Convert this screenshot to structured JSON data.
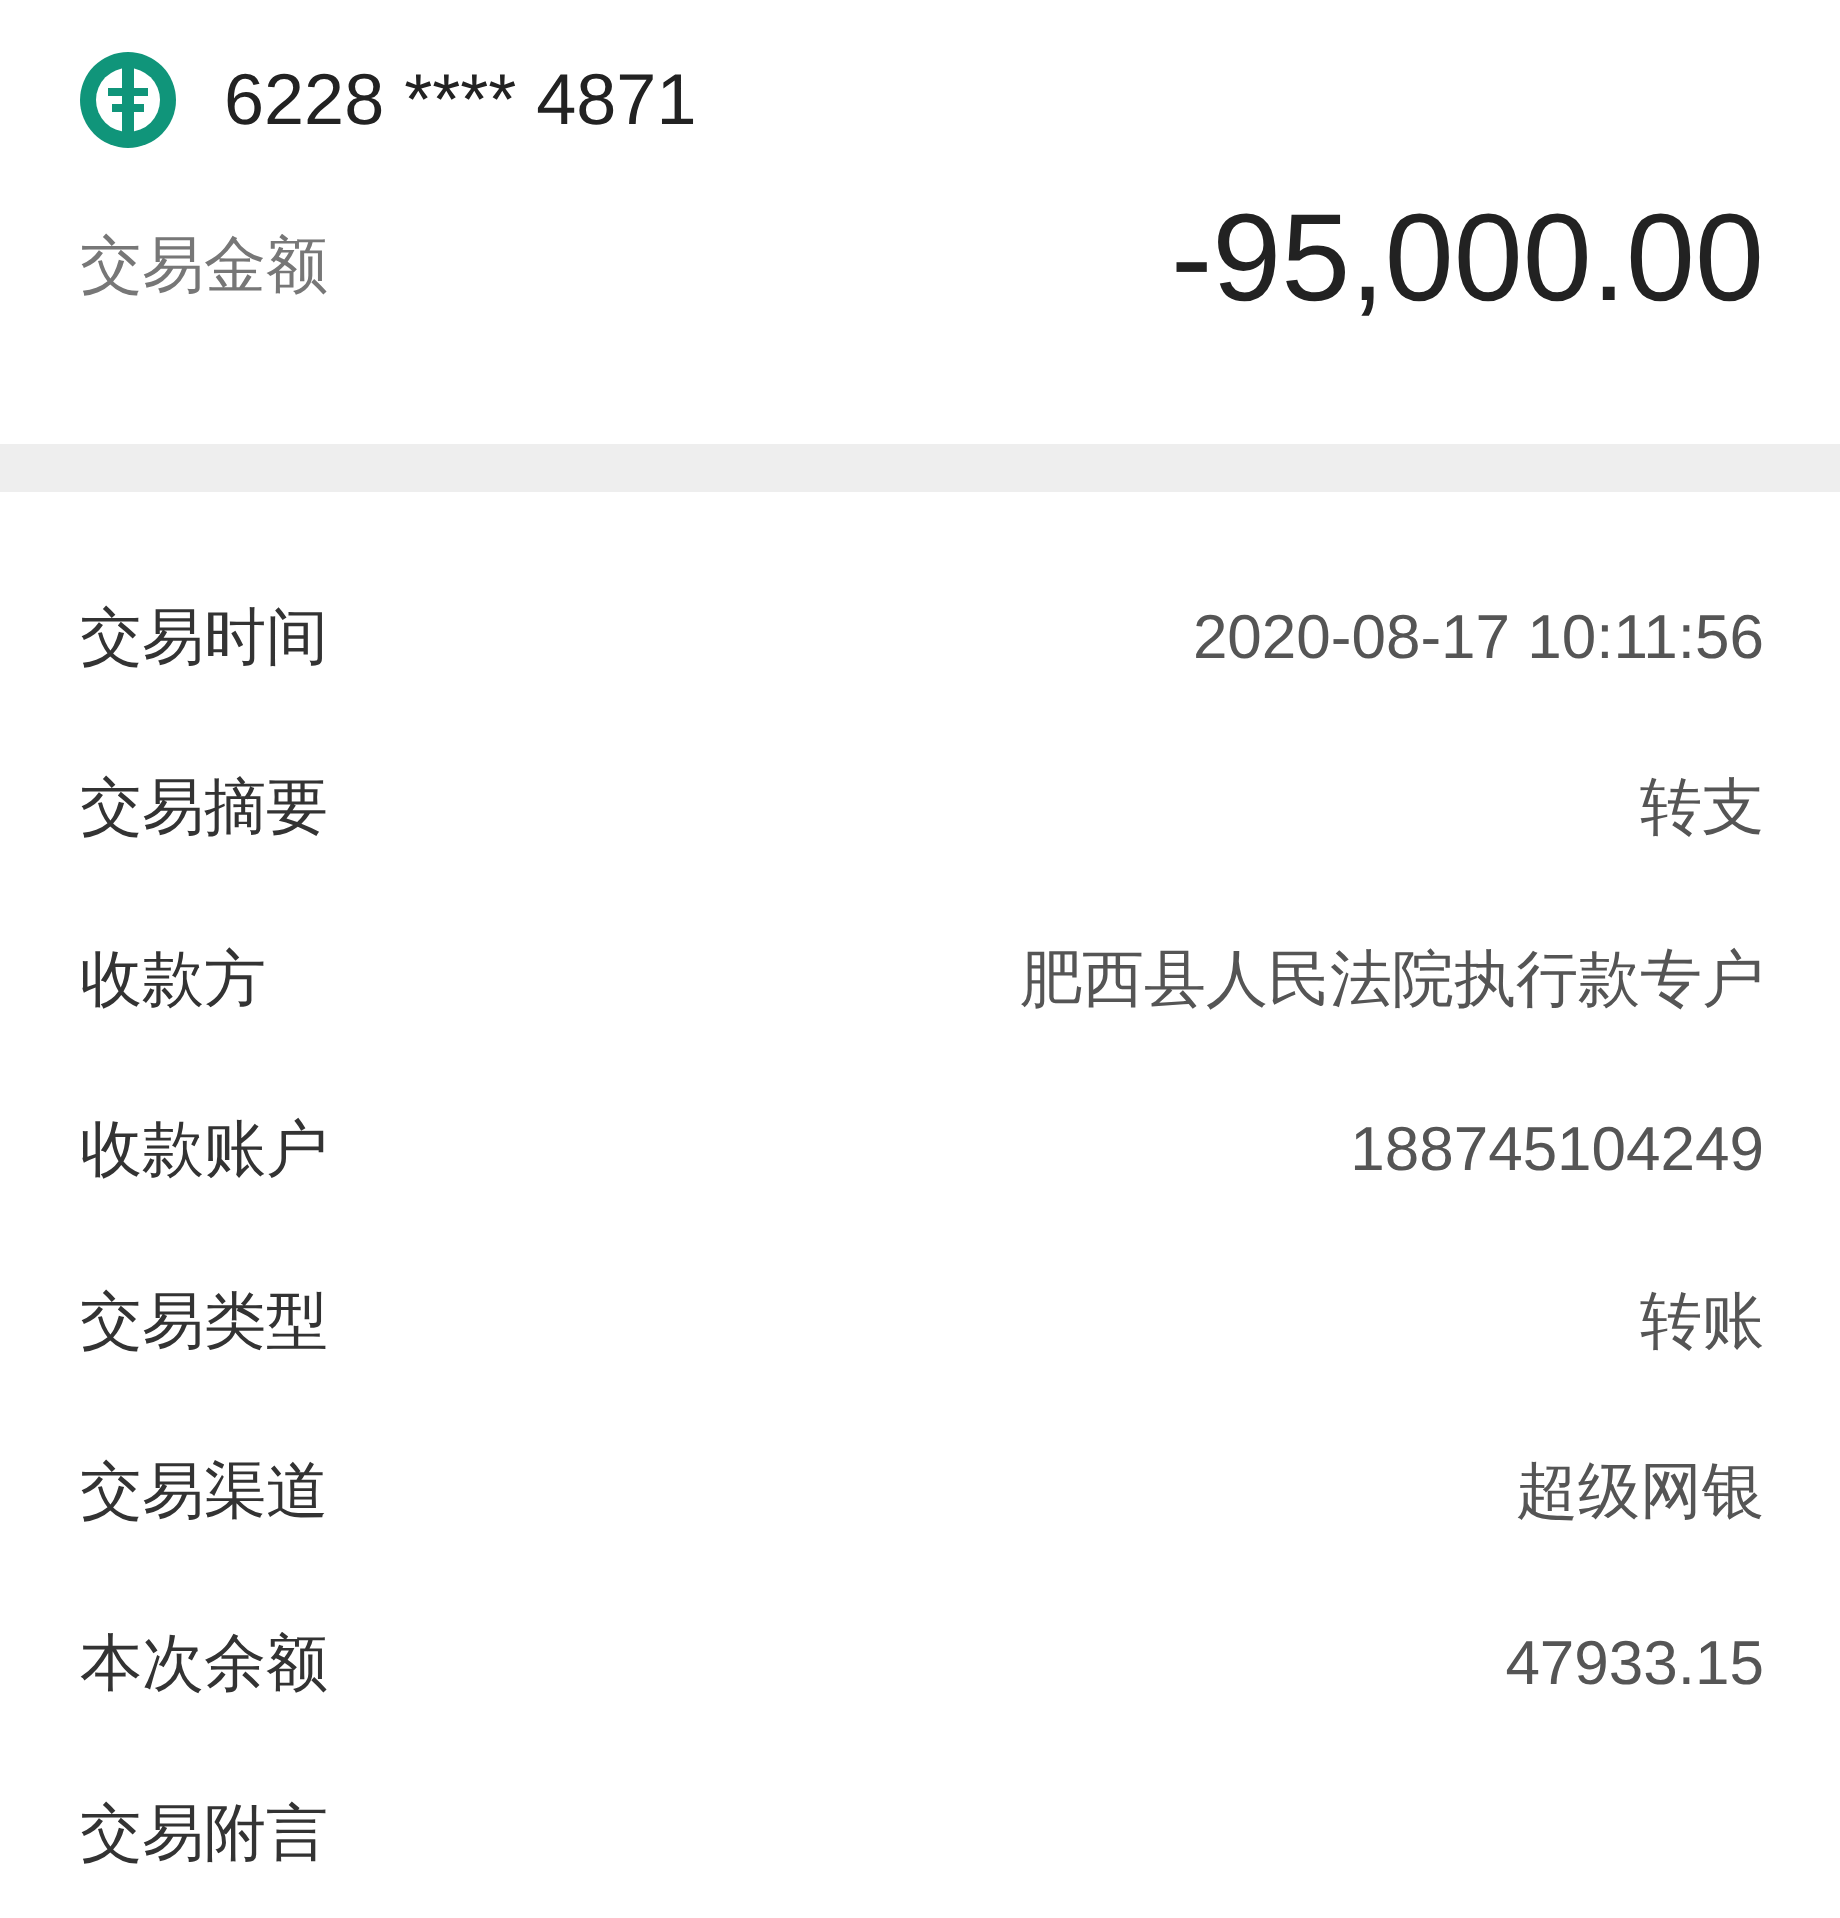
{
  "account": {
    "card_number": "6228 **** 4871"
  },
  "amount": {
    "label": "交易金额",
    "value": "-95,000.00"
  },
  "details": [
    {
      "label": "交易时间",
      "value": "2020-08-17 10:11:56"
    },
    {
      "label": "交易摘要",
      "value": "转支"
    },
    {
      "label": "收款方",
      "value": "肥西县人民法院执行款专户"
    },
    {
      "label": "收款账户",
      "value": "188745104249"
    },
    {
      "label": "交易类型",
      "value": "转账"
    },
    {
      "label": "交易渠道",
      "value": "超级网银"
    },
    {
      "label": "本次余额",
      "value": "47933.15"
    },
    {
      "label": "交易附言"
    }
  ]
}
